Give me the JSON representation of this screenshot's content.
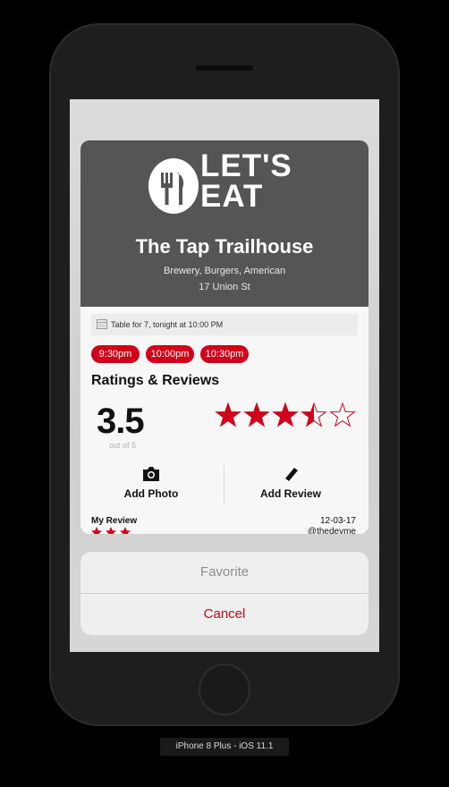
{
  "logo": {
    "line1": "LET'S",
    "line2": "EAT"
  },
  "restaurant": {
    "name": "The Tap Trailhouse",
    "cuisine": "Brewery, Burgers, American",
    "address": "17 Union St"
  },
  "reservation": {
    "summary": "Table for 7, tonight at 10:00 PM",
    "times": [
      "9:30pm",
      "10:00pm",
      "10:30pm"
    ]
  },
  "ratings": {
    "title": "Ratings & Reviews",
    "score": "3.5",
    "out_of": "out of 5",
    "stars_value": 3.5,
    "stars_max": 5
  },
  "actions": {
    "add_photo": "Add Photo",
    "add_review": "Add Review"
  },
  "my_review": {
    "label": "My Review",
    "date": "12-03-17",
    "user": "@thedevme"
  },
  "action_sheet": {
    "favorite": "Favorite",
    "cancel": "Cancel"
  },
  "device": {
    "label": "iPhone 8 Plus - iOS 11.1"
  },
  "colors": {
    "accent": "#d0021b",
    "hero": "#555555",
    "sheet": "#efefef"
  }
}
